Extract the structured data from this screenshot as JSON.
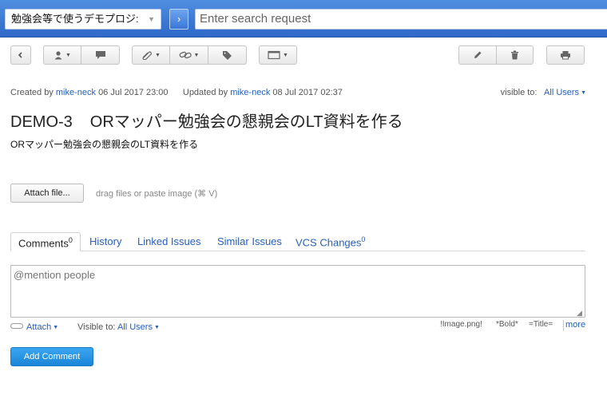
{
  "search": {
    "project_selected": "勉強会等で使うデモプロジ:",
    "placeholder": "Enter search request"
  },
  "meta": {
    "created_prefix": "Created by",
    "created_user": "mike-neck",
    "created_date": "06 Jul 2017 23:00",
    "updated_prefix": "Updated by",
    "updated_user": "mike-neck",
    "updated_date": "08 Jul 2017 02:37",
    "visible_label": "visible to:",
    "visible_value": "All Users"
  },
  "issue": {
    "key": "DEMO-3",
    "summary": "ORマッパー勉強会の懇親会のLT資料を作る",
    "description": "ORマッパー勉強会の懇親会のLT資料を作る"
  },
  "attach": {
    "button_label": "Attach file...",
    "hint": "drag files or paste image (⌘ V)"
  },
  "tabs": [
    {
      "label": "Comments",
      "count": "0"
    },
    {
      "label": "History"
    },
    {
      "label": "Linked Issues"
    },
    {
      "label": "Similar Issues"
    },
    {
      "label": "VCS Changes",
      "count": "0"
    }
  ],
  "comment": {
    "placeholder": "@mention people",
    "attach_label": "Attach",
    "visible_label": "Visible to:",
    "visible_value": "All Users",
    "markup_image": "!Image.png!",
    "markup_bold": "*Bold*",
    "markup_title": "=Title=",
    "more_label": "more",
    "submit_label": "Add Comment"
  },
  "icons": {
    "back": "arrow-left-icon",
    "assignee": "user-icon",
    "comment": "speech-bubble-icon",
    "attachment": "paperclip-icon",
    "link": "chain-link-icon",
    "tag": "tag-icon",
    "view": "window-icon",
    "edit": "pencil-icon",
    "delete": "trash-icon",
    "print": "printer-icon"
  }
}
